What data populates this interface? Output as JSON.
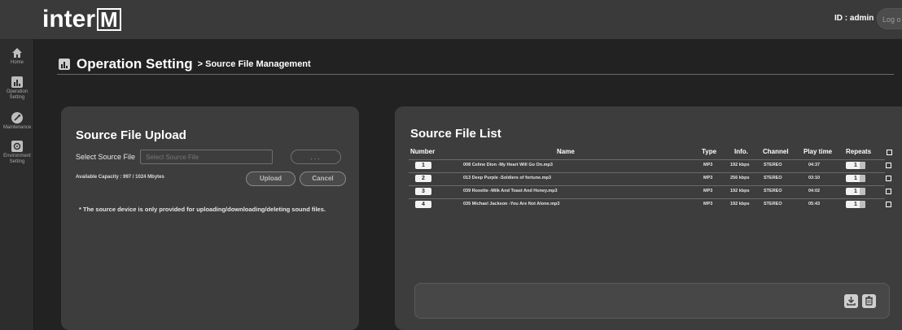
{
  "header": {
    "logo_main": "inter",
    "logo_tail": "M",
    "user_id": "ID : admin",
    "logout_label": "Log o"
  },
  "sidebar": {
    "items": [
      {
        "label": "Home",
        "icon": "home-icon"
      },
      {
        "label": "Operation Setting",
        "icon": "chart-icon"
      },
      {
        "label": "Maintenance",
        "icon": "wrench-icon"
      },
      {
        "label": "Environment Setting",
        "icon": "gear-icon"
      }
    ]
  },
  "page": {
    "title": "Operation Setting",
    "breadcrumb": "> Source File Management"
  },
  "upload": {
    "heading": "Source File Upload",
    "field_label": "Select Source File",
    "file_placeholder": "Select Source File",
    "browse_label": "...",
    "capacity": "Available Capacity : 997 / 1024 Mbytes",
    "upload_label": "Upload",
    "cancel_label": "Cancel",
    "note": "* The source device is only provided for uploading/downloading/deleting sound files."
  },
  "list": {
    "heading": "Source File List",
    "columns": {
      "number": "Number",
      "name": "Name",
      "type": "Type",
      "info": "Info.",
      "channel": "Channel",
      "playtime": "Play time",
      "repeats": "Repeats"
    },
    "rows": [
      {
        "number": "1",
        "name": "008 Celine Dion -My Heart Will Go On.mp3",
        "type": "MP3",
        "info": "192 kbps",
        "channel": "STEREO",
        "playtime": "04:37",
        "repeats": "1"
      },
      {
        "number": "2",
        "name": "013 Deep Purple -Soldiers of fortune.mp3",
        "type": "MP3",
        "info": "256 kbps",
        "channel": "STEREO",
        "playtime": "03:10",
        "repeats": "1"
      },
      {
        "number": "3",
        "name": "039 Roxette -Milk And Toast And Honey.mp3",
        "type": "MP3",
        "info": "192 kbps",
        "channel": "STEREO",
        "playtime": "04:02",
        "repeats": "1"
      },
      {
        "number": "4",
        "name": "035 Michael Jackson -You Are Not Alone.mp3",
        "type": "MP3",
        "info": "192 kbps",
        "channel": "STEREO",
        "playtime": "05:43",
        "repeats": "1"
      }
    ],
    "download_icon": "download-icon",
    "delete_icon": "trash-icon"
  }
}
